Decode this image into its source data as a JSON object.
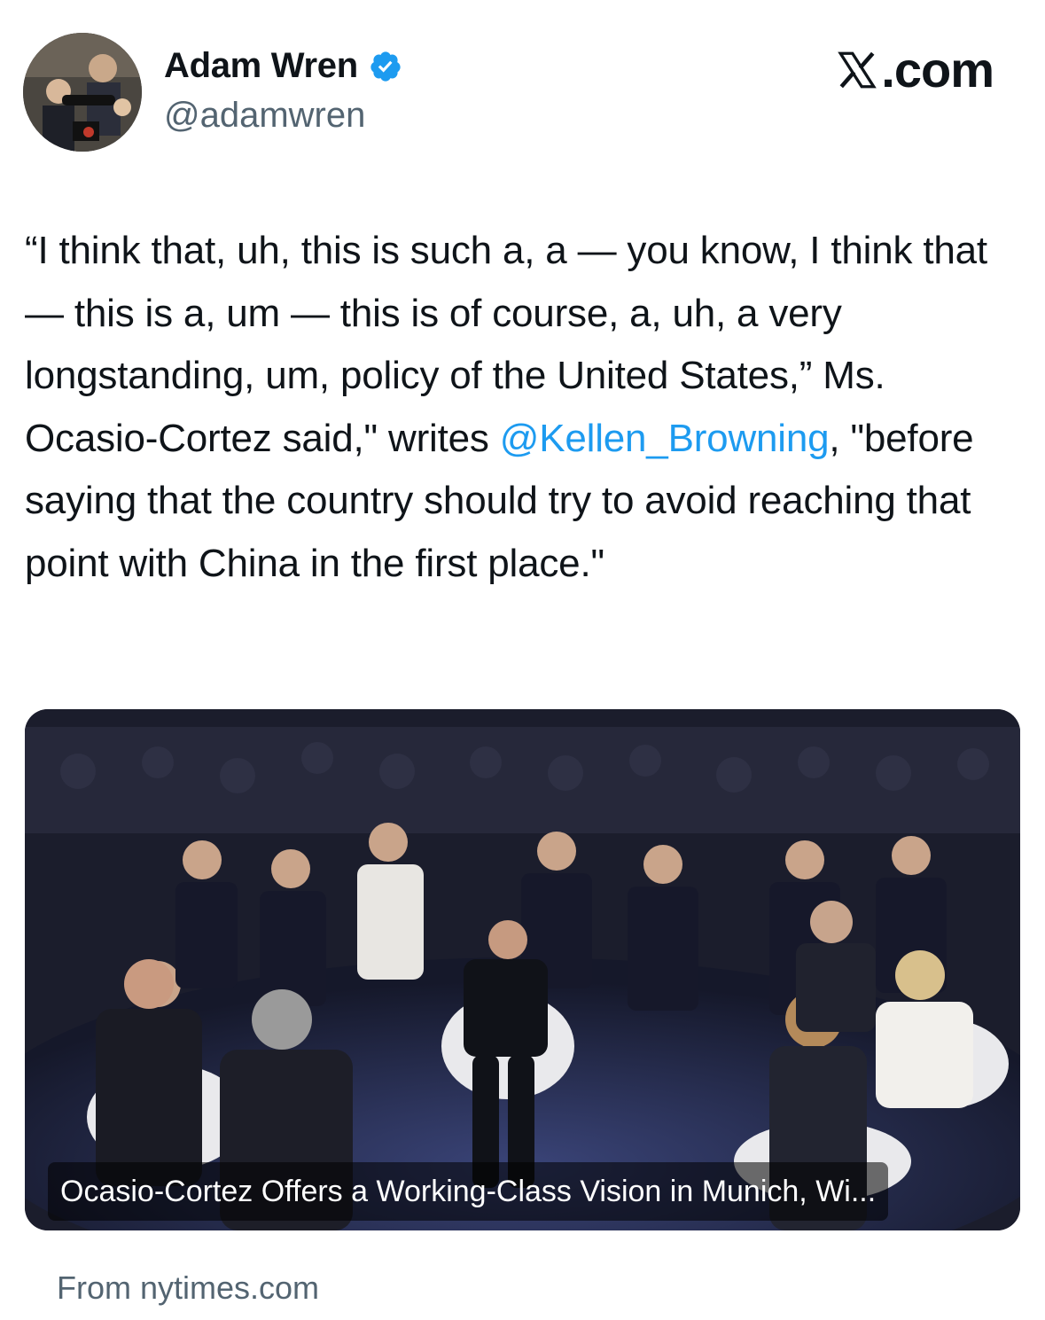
{
  "author": {
    "display_name": "Adam Wren",
    "handle": "@adamwren",
    "verified": true,
    "verified_color": "#1d9bf0"
  },
  "brand": {
    "label": ".com",
    "icon": "x-logo-icon"
  },
  "tweet": {
    "text_before": "“I think that, uh, this is such a, a — you know, I think that — this is a, um — this is of course, a, uh, a very longstanding, um, policy of the United States,” Ms. Ocasio-Cortez said,\" writes ",
    "mention": "@Kellen_Browning",
    "text_after": ", \"before saying that the country should try to avoid reaching that point with China in the first place.\""
  },
  "card": {
    "headline": "Ocasio-Cortez Offers a Working-Class Vision in Munich, Wi...",
    "source": "From nytimes.com"
  },
  "colors": {
    "text_primary": "#0f1419",
    "text_secondary": "#536471",
    "link": "#1d9bf0"
  }
}
